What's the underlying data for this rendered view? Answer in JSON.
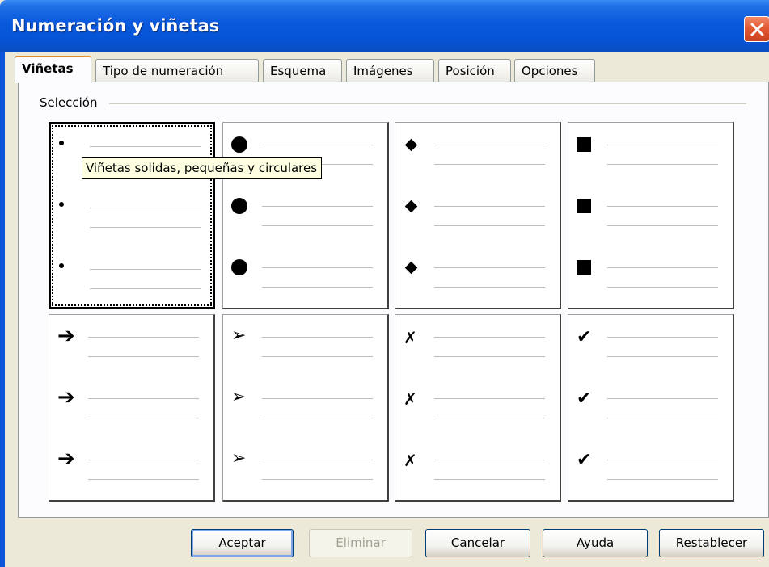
{
  "window": {
    "title": "Numeración y viñetas"
  },
  "tabs": [
    {
      "label": "Viñetas",
      "active": true
    },
    {
      "label": "Tipo de numeración"
    },
    {
      "label": "Esquema"
    },
    {
      "label": "Imágenes"
    },
    {
      "label": "Posición"
    },
    {
      "label": "Opciones"
    }
  ],
  "selection": {
    "label": "Selección",
    "tooltip": "Viñetas solidas, pequeñas y circulares",
    "bullets": [
      {
        "name": "small-circle",
        "glyph": ""
      },
      {
        "name": "large-circle",
        "glyph": ""
      },
      {
        "name": "diamond",
        "glyph": ""
      },
      {
        "name": "square",
        "glyph": ""
      },
      {
        "name": "arrow",
        "glyph": "➔"
      },
      {
        "name": "arrowhead",
        "glyph": "➢"
      },
      {
        "name": "cross",
        "glyph": "✗"
      },
      {
        "name": "checkmark",
        "glyph": "✔"
      }
    ]
  },
  "buttons": {
    "ok": {
      "label": "Aceptar"
    },
    "delete": {
      "pre": "",
      "key": "E",
      "post": "liminar"
    },
    "cancel": {
      "label": "Cancelar"
    },
    "help": {
      "pre": "Ay",
      "key": "u",
      "post": "da"
    },
    "reset": {
      "pre": "",
      "key": "R",
      "post": "establecer"
    }
  },
  "colors": {
    "titlebar": "#0654d6",
    "close": "#e35a32",
    "tab_highlight": "#e68b2c",
    "tooltip_bg": "#ffffe1"
  }
}
